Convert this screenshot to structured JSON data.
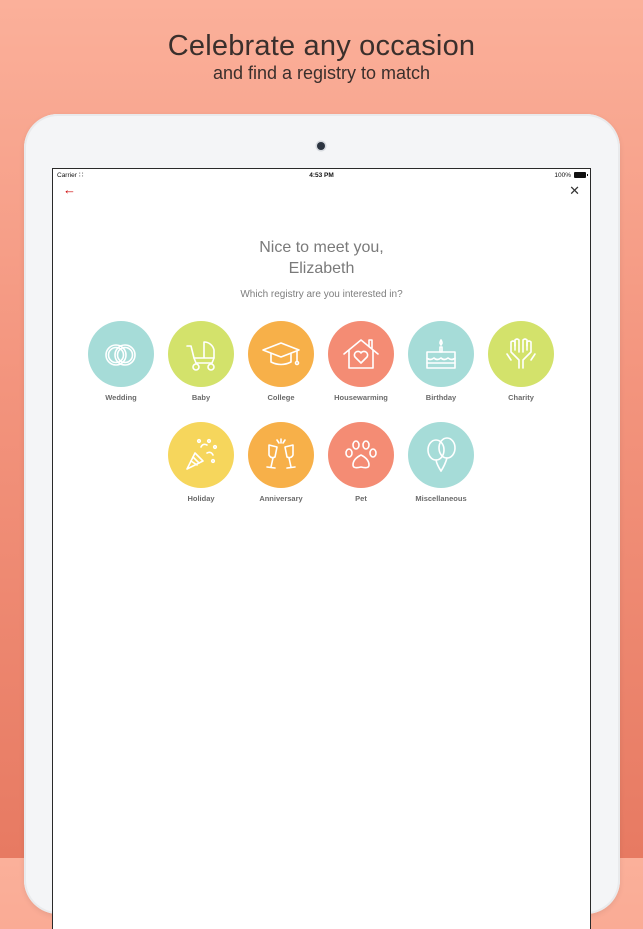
{
  "headline": {
    "title": "Celebrate any occasion",
    "subtitle": "and find a registry to match"
  },
  "status_bar": {
    "carrier": "Carrier",
    "time": "4:53 PM",
    "battery": "100%"
  },
  "nav": {
    "back_icon": "arrow-left-icon",
    "close_icon": "close-icon",
    "back_color": "#cc0000"
  },
  "greeting": {
    "line1": "Nice to meet you,",
    "line2": "Elizabeth",
    "prompt": "Which registry are you interested in?"
  },
  "colors": {
    "teal": "#a6dcd8",
    "lime": "#d3e26b",
    "orange": "#f7b049",
    "salmon": "#f48c74",
    "yellow": "#f6d65c"
  },
  "occasions": [
    {
      "label": "Wedding",
      "icon": "rings-icon",
      "color": "#a6dcd8"
    },
    {
      "label": "Baby",
      "icon": "stroller-icon",
      "color": "#d3e26b"
    },
    {
      "label": "College",
      "icon": "graduation-cap-icon",
      "color": "#f7b049"
    },
    {
      "label": "Housewarming",
      "icon": "house-heart-icon",
      "color": "#f48c74"
    },
    {
      "label": "Birthday",
      "icon": "cake-icon",
      "color": "#a6dcd8"
    },
    {
      "label": "Charity",
      "icon": "hands-icon",
      "color": "#d3e26b"
    },
    {
      "label": "Holiday",
      "icon": "party-popper-icon",
      "color": "#f6d65c"
    },
    {
      "label": "Anniversary",
      "icon": "champagne-glasses-icon",
      "color": "#f7b049"
    },
    {
      "label": "Pet",
      "icon": "paw-icon",
      "color": "#f48c74"
    },
    {
      "label": "Miscellaneous",
      "icon": "balloons-icon",
      "color": "#a6dcd8"
    }
  ]
}
